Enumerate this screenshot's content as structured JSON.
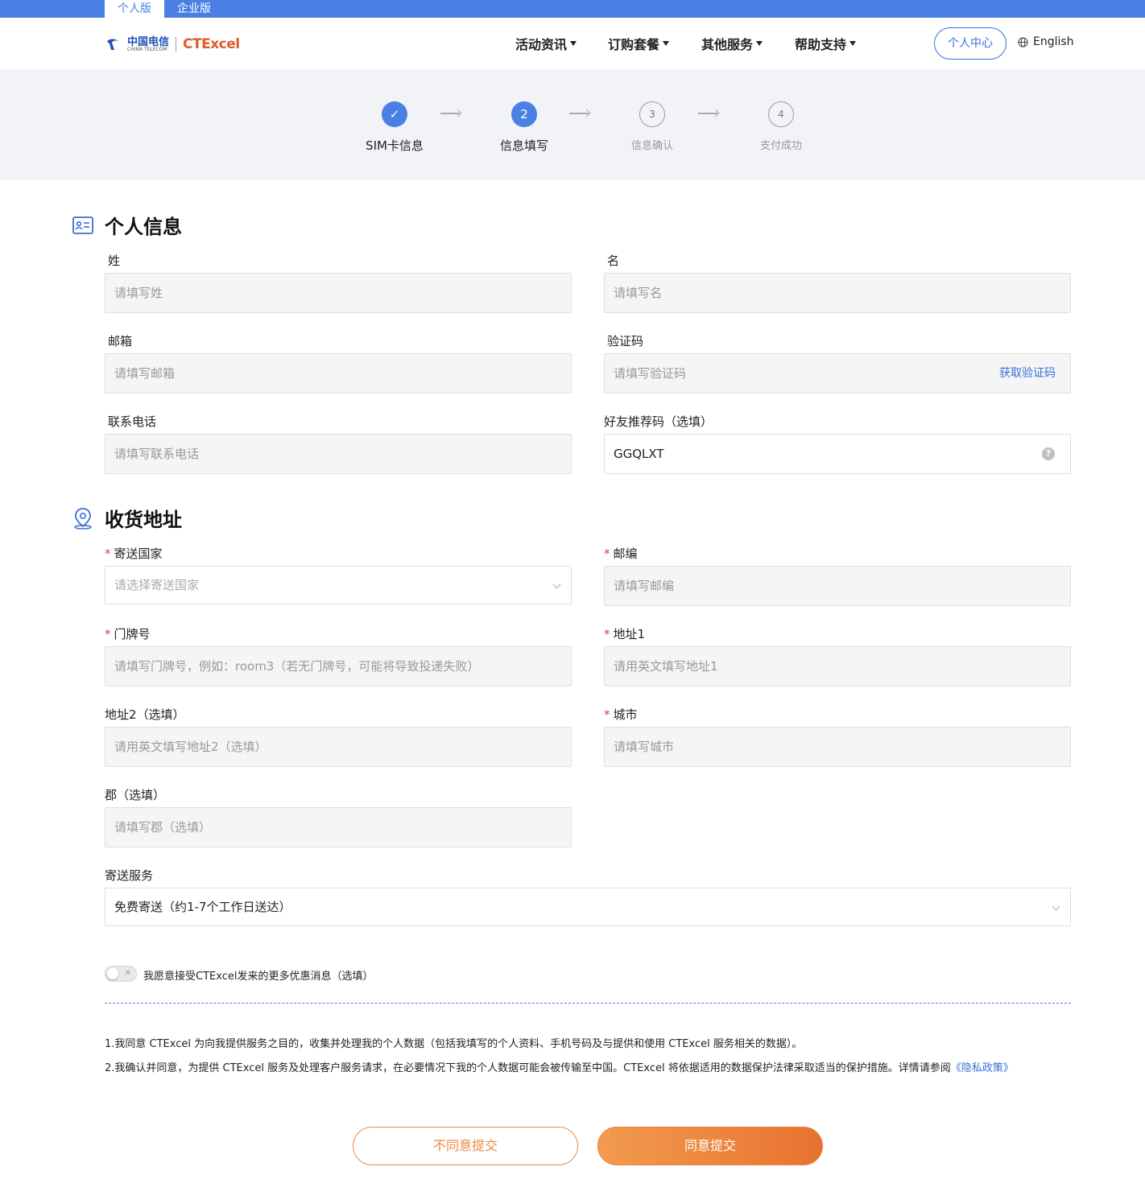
{
  "top_tabs": {
    "personal": "个人版",
    "enterprise": "企业版"
  },
  "logo": {
    "carrier": "中国电信",
    "carrier_sub": "CHINA TELECOM",
    "brand": "CTExcel"
  },
  "nav": {
    "items": [
      {
        "label": "活动资讯"
      },
      {
        "label": "订购套餐"
      },
      {
        "label": "其他服务"
      },
      {
        "label": "帮助支持"
      }
    ],
    "user_center": "个人中心",
    "language": "English"
  },
  "steps": [
    {
      "number": "✓",
      "label": "SIM卡信息",
      "state": "done"
    },
    {
      "number": "2",
      "label": "信息填写",
      "state": "current"
    },
    {
      "number": "3",
      "label": "信息确认",
      "state": "todo"
    },
    {
      "number": "4",
      "label": "支付成功",
      "state": "todo"
    }
  ],
  "personal": {
    "title": "个人信息",
    "last_name": {
      "label": "姓",
      "placeholder": "请填写姓"
    },
    "first_name": {
      "label": "名",
      "placeholder": "请填写名"
    },
    "email": {
      "label": "邮箱",
      "placeholder": "请填写邮箱"
    },
    "code": {
      "label": "验证码",
      "placeholder": "请填写验证码",
      "action": "获取验证码"
    },
    "phone": {
      "label": "联系电话",
      "placeholder": "请填写联系电话"
    },
    "referral": {
      "label": "好友推荐码（选填）",
      "value": "GGQLXT"
    }
  },
  "address": {
    "title": "收货地址",
    "required_mark": "*",
    "country": {
      "label": "寄送国家",
      "placeholder": "请选择寄送国家"
    },
    "zip": {
      "label": "邮编",
      "placeholder": "请填写邮编"
    },
    "door": {
      "label": "门牌号",
      "placeholder": "请填写门牌号，例如：room3（若无门牌号，可能将导致投递失败）"
    },
    "addr1": {
      "label": "地址1",
      "placeholder": "请用英文填写地址1"
    },
    "addr2": {
      "label": "地址2（选填）",
      "placeholder": "请用英文填写地址2（选填）"
    },
    "city": {
      "label": "城市",
      "placeholder": "请填写城市"
    },
    "county": {
      "label": "郡（选填）",
      "placeholder": "请填写郡（选填）"
    },
    "shipping": {
      "label": "寄送服务",
      "value": "免费寄送（约1-7个工作日送达）"
    }
  },
  "promo_toggle": {
    "label": "我愿意接受CTExcel发来的更多优惠消息（选填）",
    "on": false
  },
  "terms": {
    "line1": "1.我同意 CTExcel 为向我提供服务之目的，收集并处理我的个人数据（包括我填写的个人资料、手机号码及与提供和使用 CTExcel 服务相关的数据）。",
    "line2": "2.我确认并同意，为提供 CTExcel 服务及处理客户服务请求，在必要情况下我的个人数据可能会被传输至中国。CTExcel 将依据适用的数据保护法律采取适当的保护措施。详情请参阅",
    "privacy_link": "《隐私政策》"
  },
  "buttons": {
    "decline": "不同意提交",
    "agree": "同意提交"
  },
  "colors": {
    "primary": "#4a80e3",
    "accent": "#ee8a3e",
    "required": "#e53935"
  }
}
